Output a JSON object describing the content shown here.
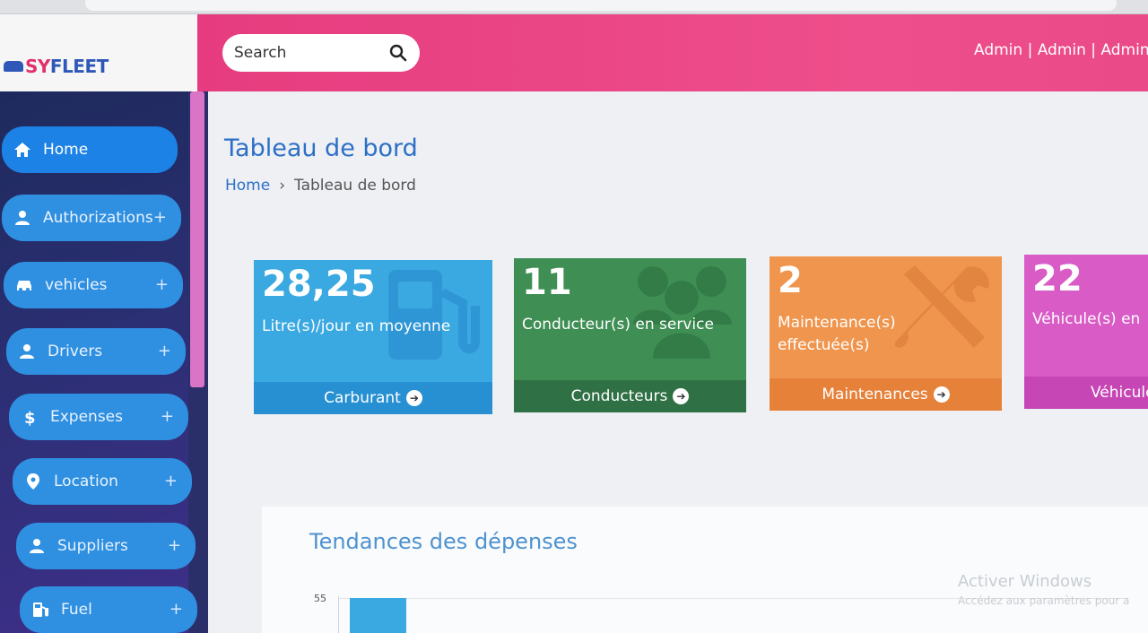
{
  "header": {
    "logo_prefix": "E",
    "logo_mid": "SY",
    "logo_suffix": "FLEET",
    "search_placeholder": "Search",
    "user_links": "Admin | Admin | Admin"
  },
  "sidebar": {
    "items": [
      {
        "label": "Home",
        "icon": "home-icon",
        "expandable": false
      },
      {
        "label": "Authorizations",
        "icon": "user-icon",
        "expandable": true
      },
      {
        "label": "vehicles",
        "icon": "car-icon",
        "expandable": true
      },
      {
        "label": "Drivers",
        "icon": "user-icon",
        "expandable": true
      },
      {
        "label": "Expenses",
        "icon": "dollar-icon",
        "expandable": true
      },
      {
        "label": "Location",
        "icon": "map-pin-icon",
        "expandable": true
      },
      {
        "label": "Suppliers",
        "icon": "user-icon",
        "expandable": true
      },
      {
        "label": "Fuel",
        "icon": "fuel-pump-icon",
        "expandable": true
      }
    ],
    "plus": "+"
  },
  "page": {
    "title": "Tableau de bord",
    "breadcrumb": {
      "home": "Home",
      "separator": "›",
      "current": "Tableau de bord"
    }
  },
  "cards": {
    "fuel": {
      "value": "28,25",
      "label": "Litre(s)/jour en moyenne",
      "link": "Carburant",
      "color": "#3aa8e1"
    },
    "drivers": {
      "value": "11",
      "label": "Conducteur(s) en service",
      "link": "Conducteurs",
      "color": "#3f8f55"
    },
    "maintenance": {
      "value": "2",
      "label": "Maintenance(s) effectuée(s)",
      "link": "Maintenances",
      "color": "#f0954d"
    },
    "vehicles": {
      "value": "22",
      "label": "Véhicule(s) en",
      "link": "Véhicule",
      "color": "#d95bc6"
    }
  },
  "expenses": {
    "title": "Tendances des dépenses",
    "chart_data": {
      "type": "bar",
      "y_tick_top": "55",
      "values": [
        55
      ]
    }
  },
  "watermark": {
    "line1": "Activer Windows",
    "line2": "Accédez aux paramètres pour a"
  }
}
